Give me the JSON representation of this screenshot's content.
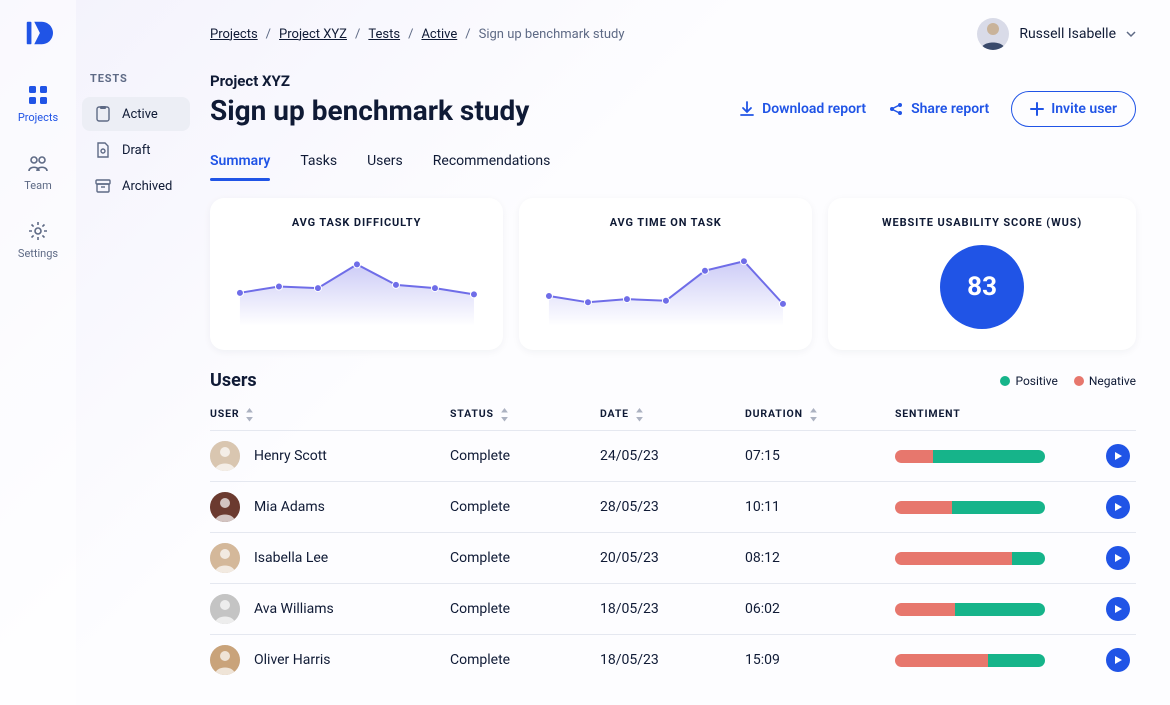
{
  "app": {
    "name": "D"
  },
  "rail": {
    "items": [
      {
        "id": "projects",
        "label": "Projects",
        "active": true
      },
      {
        "id": "team",
        "label": "Team",
        "active": false
      },
      {
        "id": "settings",
        "label": "Settings",
        "active": false
      }
    ]
  },
  "panel": {
    "title": "TESTS",
    "items": [
      {
        "id": "active",
        "label": "Active",
        "icon": "clipboard",
        "active": true
      },
      {
        "id": "draft",
        "label": "Draft",
        "icon": "file",
        "active": false
      },
      {
        "id": "archived",
        "label": "Archived",
        "icon": "archive",
        "active": false
      }
    ]
  },
  "breadcrumb": {
    "links": [
      {
        "label": "Projects",
        "href": true
      },
      {
        "label": "Project XYZ",
        "href": true
      },
      {
        "label": "Tests",
        "href": true
      },
      {
        "label": "Active",
        "href": true
      }
    ],
    "current": "Sign up benchmark study"
  },
  "user": {
    "name": "Russell Isabelle"
  },
  "header": {
    "project": "Project XYZ",
    "title": "Sign up benchmark study",
    "actions": {
      "download": "Download report",
      "share": "Share report",
      "invite": "Invite user"
    }
  },
  "tabs": [
    {
      "label": "Summary",
      "active": true
    },
    {
      "label": "Tasks",
      "active": false
    },
    {
      "label": "Users",
      "active": false
    },
    {
      "label": "Recommendations",
      "active": false
    }
  ],
  "cards": {
    "difficulty": {
      "title": "AVG TASK DIFFICULTY"
    },
    "time": {
      "title": "AVG TIME ON TASK"
    },
    "wus": {
      "title": "WEBSITE USABILITY SCORE (WUS)",
      "value": "83"
    }
  },
  "chart_data": [
    {
      "id": "difficulty",
      "type": "line",
      "title": "AVG TASK DIFFICULTY",
      "x": [
        1,
        2,
        3,
        4,
        5,
        6,
        7
      ],
      "values": [
        42,
        50,
        48,
        78,
        52,
        48,
        40
      ],
      "ylim": [
        0,
        100
      ]
    },
    {
      "id": "time",
      "type": "line",
      "title": "AVG TIME ON TASK",
      "x": [
        1,
        2,
        3,
        4,
        5,
        6,
        7
      ],
      "values": [
        38,
        30,
        34,
        32,
        70,
        82,
        28
      ],
      "ylim": [
        0,
        100
      ]
    }
  ],
  "users_section": {
    "title": "Users",
    "legend": {
      "positive": "Positive",
      "negative": "Negative"
    },
    "columns": {
      "user": "USER",
      "status": "STATUS",
      "date": "DATE",
      "duration": "DURATION",
      "sentiment": "SENTIMENT"
    },
    "rows": [
      {
        "name": "Henry Scott",
        "status": "Complete",
        "date": "24/05/23",
        "duration": "07:15",
        "positive": 75
      },
      {
        "name": "Mia Adams",
        "status": "Complete",
        "date": "28/05/23",
        "duration": "10:11",
        "positive": 62
      },
      {
        "name": "Isabella Lee",
        "status": "Complete",
        "date": "20/05/23",
        "duration": "08:12",
        "positive": 22
      },
      {
        "name": "Ava Williams",
        "status": "Complete",
        "date": "18/05/23",
        "duration": "06:02",
        "positive": 60
      },
      {
        "name": "Oliver Harris",
        "status": "Complete",
        "date": "18/05/23",
        "duration": "15:09",
        "positive": 38
      }
    ]
  },
  "colors": {
    "blue": "#2054e6",
    "green": "#16b48a",
    "red": "#e7776d",
    "purple": "#6f6de8"
  }
}
